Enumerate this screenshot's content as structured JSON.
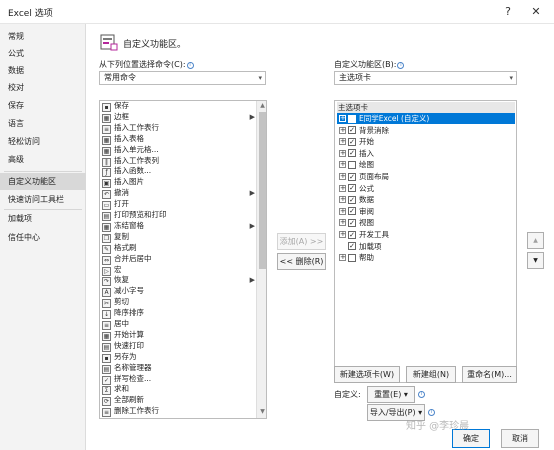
{
  "window": {
    "title": "Excel 选项",
    "help_icon": "?",
    "close_icon": "✕"
  },
  "nav": {
    "items": [
      "常规",
      "公式",
      "数据",
      "校对",
      "保存",
      "语言",
      "轻松访问",
      "高级",
      "自定义功能区",
      "快速访问工具栏",
      "加载项",
      "信任中心"
    ],
    "active_index": 8
  },
  "header": {
    "title": "自定义功能区。"
  },
  "left_panel": {
    "label": "从下列位置选择命令(C):",
    "combo_value": "常用命令",
    "commands": [
      {
        "label": "保存",
        "icon": "save-icon",
        "glyph": "▪",
        "submenu": false
      },
      {
        "label": "边框",
        "icon": "border-icon",
        "glyph": "▦",
        "submenu": true
      },
      {
        "label": "插入工作表行",
        "icon": "insert-row-icon",
        "glyph": "≡",
        "submenu": false
      },
      {
        "label": "插入表格",
        "icon": "insert-table-icon",
        "glyph": "▦",
        "submenu": false
      },
      {
        "label": "插入单元格...",
        "icon": "insert-cell-icon",
        "glyph": "▦",
        "submenu": false
      },
      {
        "label": "插入工作表列",
        "icon": "insert-column-icon",
        "glyph": "‖",
        "submenu": false
      },
      {
        "label": "插入函数...",
        "icon": "function-icon",
        "glyph": "ƒ",
        "submenu": false
      },
      {
        "label": "插入图片",
        "icon": "picture-icon",
        "glyph": "▣",
        "submenu": false
      },
      {
        "label": "撤消",
        "icon": "undo-icon",
        "glyph": "↶",
        "submenu": true
      },
      {
        "label": "打开",
        "icon": "open-icon",
        "glyph": "▭",
        "submenu": false
      },
      {
        "label": "打印预览和打印",
        "icon": "print-preview-icon",
        "glyph": "▤",
        "submenu": false
      },
      {
        "label": "冻结窗格",
        "icon": "freeze-panes-icon",
        "glyph": "▦",
        "submenu": true
      },
      {
        "label": "复制",
        "icon": "copy-icon",
        "glyph": "❐",
        "submenu": false
      },
      {
        "label": "格式刷",
        "icon": "format-painter-icon",
        "glyph": "✎",
        "submenu": false
      },
      {
        "label": "合并后居中",
        "icon": "merge-center-icon",
        "glyph": "⇔",
        "submenu": false
      },
      {
        "label": "宏",
        "icon": "macro-icon",
        "glyph": "▷",
        "submenu": false
      },
      {
        "label": "恢复",
        "icon": "redo-icon",
        "glyph": "↷",
        "submenu": true
      },
      {
        "label": "减小字号",
        "icon": "decrease-font-icon",
        "glyph": "A",
        "submenu": false
      },
      {
        "label": "剪切",
        "icon": "cut-icon",
        "glyph": "✂",
        "submenu": false
      },
      {
        "label": "降序排序",
        "icon": "sort-desc-icon",
        "glyph": "↓",
        "submenu": false
      },
      {
        "label": "居中",
        "icon": "center-icon",
        "glyph": "≡",
        "submenu": false
      },
      {
        "label": "开始计算",
        "icon": "calculate-icon",
        "glyph": "▦",
        "submenu": false
      },
      {
        "label": "快速打印",
        "icon": "quick-print-icon",
        "glyph": "▤",
        "submenu": false
      },
      {
        "label": "另存为",
        "icon": "save-as-icon",
        "glyph": "▪",
        "submenu": false
      },
      {
        "label": "名称管理器",
        "icon": "name-manager-icon",
        "glyph": "▤",
        "submenu": false
      },
      {
        "label": "拼写检查...",
        "icon": "spell-check-icon",
        "glyph": "✓",
        "submenu": false
      },
      {
        "label": "求和",
        "icon": "sum-icon",
        "glyph": "Σ",
        "submenu": false
      },
      {
        "label": "全部刷新",
        "icon": "refresh-all-icon",
        "glyph": "⟳",
        "submenu": false
      },
      {
        "label": "删除工作表行",
        "icon": "delete-row-icon",
        "glyph": "≡",
        "submenu": false
      }
    ]
  },
  "middle": {
    "add_label": "添加(A) >>",
    "remove_label": "<< 删除(R)"
  },
  "right_panel": {
    "label": "自定义功能区(B):",
    "combo_value": "主选项卡",
    "tree_header": "主选项卡",
    "tabs": [
      {
        "label": "E同学Excel (自定义)",
        "checked": false,
        "expander": "⊞",
        "selected": true
      },
      {
        "label": "背景消除",
        "checked": true,
        "expander": "⊞",
        "selected": false
      },
      {
        "label": "开始",
        "checked": true,
        "expander": "⊞",
        "selected": false
      },
      {
        "label": "插入",
        "checked": true,
        "expander": "⊞",
        "selected": false
      },
      {
        "label": "绘图",
        "checked": false,
        "expander": "⊞",
        "selected": false
      },
      {
        "label": "页面布局",
        "checked": true,
        "expander": "⊞",
        "selected": false
      },
      {
        "label": "公式",
        "checked": true,
        "expander": "⊞",
        "selected": false
      },
      {
        "label": "数据",
        "checked": true,
        "expander": "⊞",
        "selected": false
      },
      {
        "label": "审阅",
        "checked": true,
        "expander": "⊞",
        "selected": false
      },
      {
        "label": "视图",
        "checked": true,
        "expander": "⊞",
        "selected": false
      },
      {
        "label": "开发工具",
        "checked": true,
        "expander": "⊞",
        "selected": false
      },
      {
        "label": "加载项",
        "checked": true,
        "expander": "",
        "selected": false
      },
      {
        "label": "帮助",
        "checked": false,
        "expander": "⊞",
        "selected": false
      }
    ],
    "move_up": "▲",
    "move_down": "▼",
    "new_tab_label": "新建选项卡(W)",
    "new_group_label": "新建组(N)",
    "rename_label": "重命名(M)...",
    "customize_label": "自定义:",
    "reset_label": "重置(E) ▾",
    "import_export_label": "导入/导出(P) ▾"
  },
  "footer": {
    "ok_label": "确定",
    "cancel_label": "取消"
  },
  "watermark": "知乎 @李珍晨"
}
